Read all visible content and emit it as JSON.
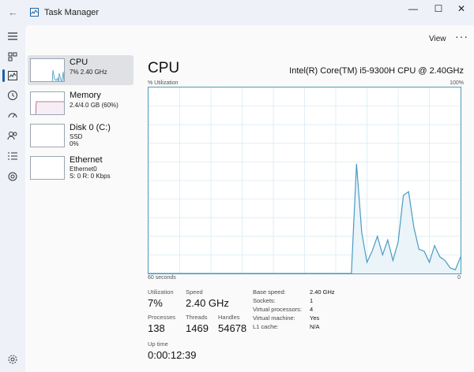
{
  "window": {
    "title": "Task Manager",
    "minimize": "—",
    "maximize": "☐",
    "close": "✕"
  },
  "toolbar": {
    "view_label": "View",
    "more_label": "···"
  },
  "resources": [
    {
      "name": "CPU",
      "line1": "7% 2.40 GHz",
      "line2": ""
    },
    {
      "name": "Memory",
      "line1": "2.4/4.0 GB (60%)",
      "line2": ""
    },
    {
      "name": "Disk 0 (C:)",
      "line1": "SSD",
      "line2": "0%"
    },
    {
      "name": "Ethernet",
      "line1": "Ethernet0",
      "line2": "S: 0 R: 0 Kbps"
    }
  ],
  "detail": {
    "title": "CPU",
    "cpu_model": "Intel(R) Core(TM) i5-9300H CPU @ 2.40GHz",
    "graph_top_left": "% Utilization",
    "graph_top_right": "100%",
    "graph_bottom_left": "60 seconds",
    "graph_bottom_right": "0",
    "stats": {
      "utilization_label": "Utilization",
      "utilization": "7%",
      "speed_label": "Speed",
      "speed": "2.40 GHz",
      "processes_label": "Processes",
      "processes": "138",
      "threads_label": "Threads",
      "threads": "1469",
      "handles_label": "Handles",
      "handles": "54678",
      "uptime_label": "Up time",
      "uptime": "0:00:12:39"
    },
    "specs": [
      {
        "key": "Base speed:",
        "value": "2.40 GHz"
      },
      {
        "key": "Sockets:",
        "value": "1"
      },
      {
        "key": "Virtual processors:",
        "value": "4"
      },
      {
        "key": "Virtual machine:",
        "value": "Yes"
      },
      {
        "key": "L1 cache:",
        "value": "N/A"
      }
    ]
  },
  "chart_data": {
    "type": "area",
    "x": [
      0,
      1,
      2,
      3,
      4,
      5,
      6,
      7,
      8,
      9,
      10,
      11,
      12,
      13,
      14,
      15,
      16,
      17,
      18,
      19,
      20,
      21,
      22,
      23,
      24,
      25,
      26,
      27,
      28,
      29,
      30,
      31,
      32,
      33,
      34,
      35,
      36,
      37,
      38,
      39,
      40,
      41,
      42,
      43,
      44,
      45,
      46,
      47,
      48,
      49,
      50,
      51,
      52,
      53,
      54,
      55,
      56,
      57,
      58,
      59,
      60
    ],
    "values": [
      0,
      0,
      0,
      0,
      0,
      0,
      0,
      0,
      0,
      0,
      0,
      0,
      0,
      0,
      0,
      0,
      0,
      0,
      0,
      0,
      0,
      0,
      0,
      0,
      0,
      0,
      0,
      0,
      0,
      0,
      0,
      0,
      0,
      0,
      0,
      0,
      0,
      0,
      0,
      0,
      59,
      22,
      6,
      12,
      20,
      10,
      18,
      7,
      17,
      42,
      44,
      25,
      13,
      12,
      6,
      15,
      9,
      7,
      3,
      2,
      9
    ],
    "xlim": [
      60,
      0
    ],
    "ylim": [
      0,
      100
    ],
    "colors": {
      "line": "#4b9bc0",
      "fill": "#eaf4f9",
      "grid": "#d9ebf3"
    }
  }
}
